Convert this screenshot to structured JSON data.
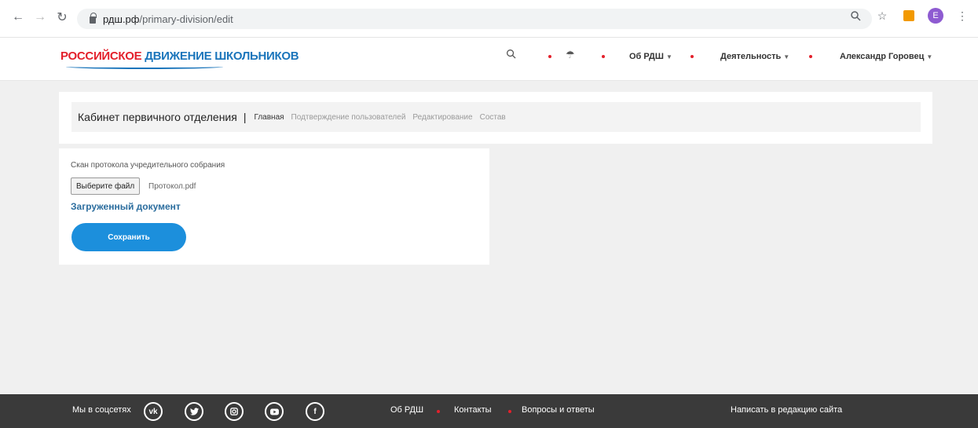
{
  "browser": {
    "url_host": "рдш.рф",
    "url_path": "/primary-division/edit",
    "profile_initial": "E",
    "icons": [
      "back-arrow-icon",
      "forward-arrow-icon",
      "reload-icon",
      "lock-icon",
      "zoom-icon",
      "star-icon",
      "extension-icon",
      "menu-dots-icon"
    ]
  },
  "header": {
    "logo_part1": "РОССИЙСКОЕ",
    "logo_part2": "ДВИЖЕНИЕ ШКОЛЬНИКОВ",
    "menu": [
      {
        "label": "Об РДШ"
      },
      {
        "label": "Деятельность"
      },
      {
        "label": "Александр Горовец"
      }
    ],
    "colors": {
      "accent_red": "#e3202b",
      "brand_blue": "#1b75bb"
    }
  },
  "cabinet": {
    "title": "Кабинет первичного отделения",
    "separator": "|",
    "tabs": [
      {
        "label": "Главная"
      },
      {
        "label": "Подтверждение пользователей"
      },
      {
        "label": "Редактирование"
      },
      {
        "label": "Состав"
      }
    ]
  },
  "form": {
    "scan_label": "Скан протокола учредительного собрания",
    "file_button": "Выберите файл",
    "file_name": "Протокол.pdf",
    "uploaded_link": "Загруженный документ",
    "save_button": "Сохранить",
    "save_color": "#1c8fdc"
  },
  "footer": {
    "social_label": "Мы в соцсетях",
    "social_icons": [
      "vk-icon",
      "twitter-icon",
      "instagram-icon",
      "youtube-icon",
      "facebook-icon"
    ],
    "links": [
      {
        "label": "Об РДШ"
      },
      {
        "label": "Контакты"
      },
      {
        "label": "Вопросы и ответы"
      }
    ],
    "write_link": "Написать в редакцию сайта"
  }
}
